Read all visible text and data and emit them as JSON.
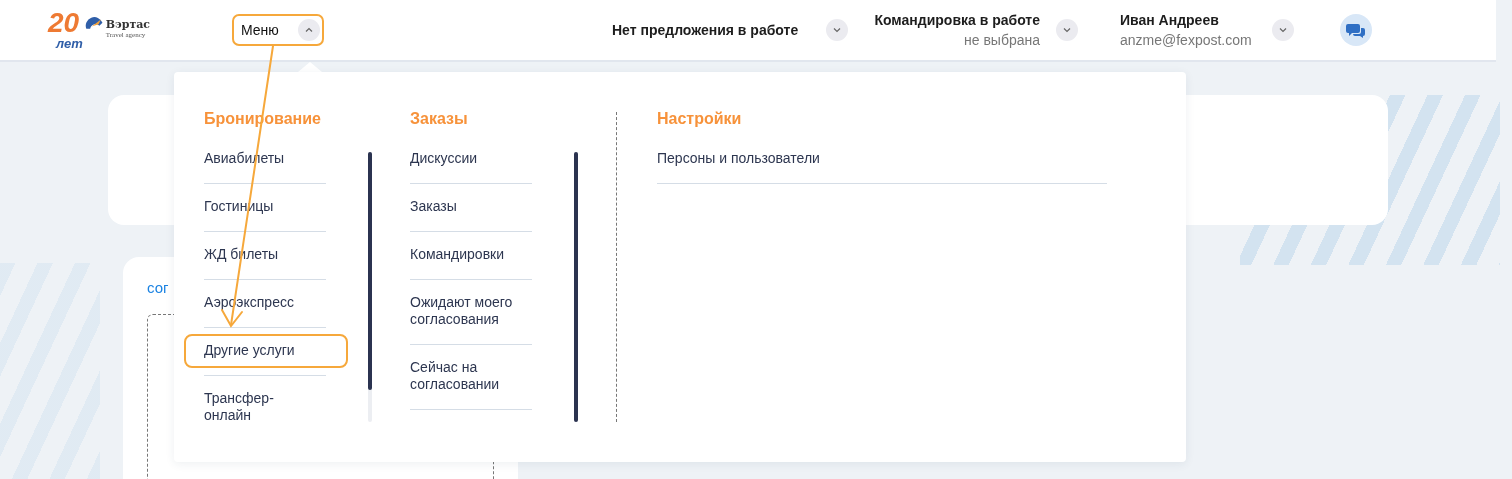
{
  "header": {
    "logo": {
      "badge": "20",
      "badge_sub": "лет",
      "name": "Вэртас",
      "tagline": "Travel agency"
    },
    "menu_button": {
      "label": "Меню",
      "expanded": true,
      "highlighted": true
    },
    "offer": {
      "label": "Нет предложения в работе"
    },
    "trip": {
      "label": "Командировка в работе",
      "value": "не выбрана"
    },
    "user": {
      "name": "Иван Андреев",
      "email": "anzme@fexpost.com"
    }
  },
  "background": {
    "card_text": "сог"
  },
  "menu": {
    "columns": [
      {
        "title": "Бронирование",
        "kind": "scrolling",
        "items": [
          {
            "label": "Авиабилеты",
            "highlighted": false
          },
          {
            "label": "Гостиницы",
            "highlighted": false
          },
          {
            "label": "ЖД билеты",
            "highlighted": false
          },
          {
            "label": "Аэроэкспресс",
            "highlighted": false
          },
          {
            "label": "Другие услуги",
            "highlighted": true
          },
          {
            "label": "Трансфер-онлайн",
            "highlighted": false
          }
        ]
      },
      {
        "title": "Заказы",
        "kind": "scrolling",
        "items": [
          {
            "label": "Дискуссии",
            "highlighted": false
          },
          {
            "label": "Заказы",
            "highlighted": false
          },
          {
            "label": "Командировки",
            "highlighted": false
          },
          {
            "label": "Ожидают моего согласования",
            "highlighted": false
          },
          {
            "label": "Сейчас на согласовании",
            "highlighted": false
          }
        ]
      },
      {
        "title": "Настройки",
        "kind": "plain",
        "items": [
          {
            "label": "Персоны и пользователи",
            "highlighted": false
          }
        ]
      }
    ]
  }
}
